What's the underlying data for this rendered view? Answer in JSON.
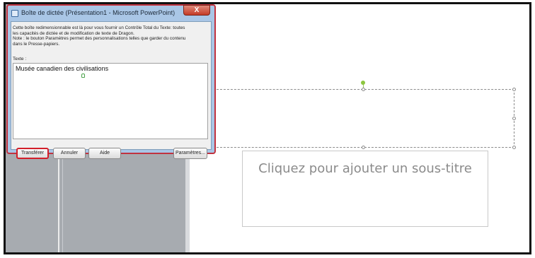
{
  "dialog": {
    "title": "Boîte de dictée (Présentation1 - Microsoft PowerPoint)",
    "close_label": "X",
    "description_lines": [
      "Cette boîte redimensionnable est là pour vous fournir un Contrôle Total du Texte: toutes",
      "les capacités de dictée et de modification de texte de Dragon.",
      "Note : le bouton Paramètres permet des personnalisations telles que garder du contenu",
      "dans le Presse-papiers."
    ],
    "text_label": "Texte :",
    "dictated_text": "Musée canadien des civilisations",
    "buttons": {
      "transferer": "Transférer",
      "annuler": "Annuler",
      "aide": "Aide",
      "parametres": "Paramètres..."
    }
  },
  "slide": {
    "subtitle_placeholder": "Cliquez pour ajouter un sous-titre"
  },
  "colors": {
    "dialog_highlight": "#c1323f",
    "transfer_highlight": "#d21f2a",
    "thumbnail_pane": "#a7abb0",
    "rotation_handle": "#8dc63f"
  }
}
